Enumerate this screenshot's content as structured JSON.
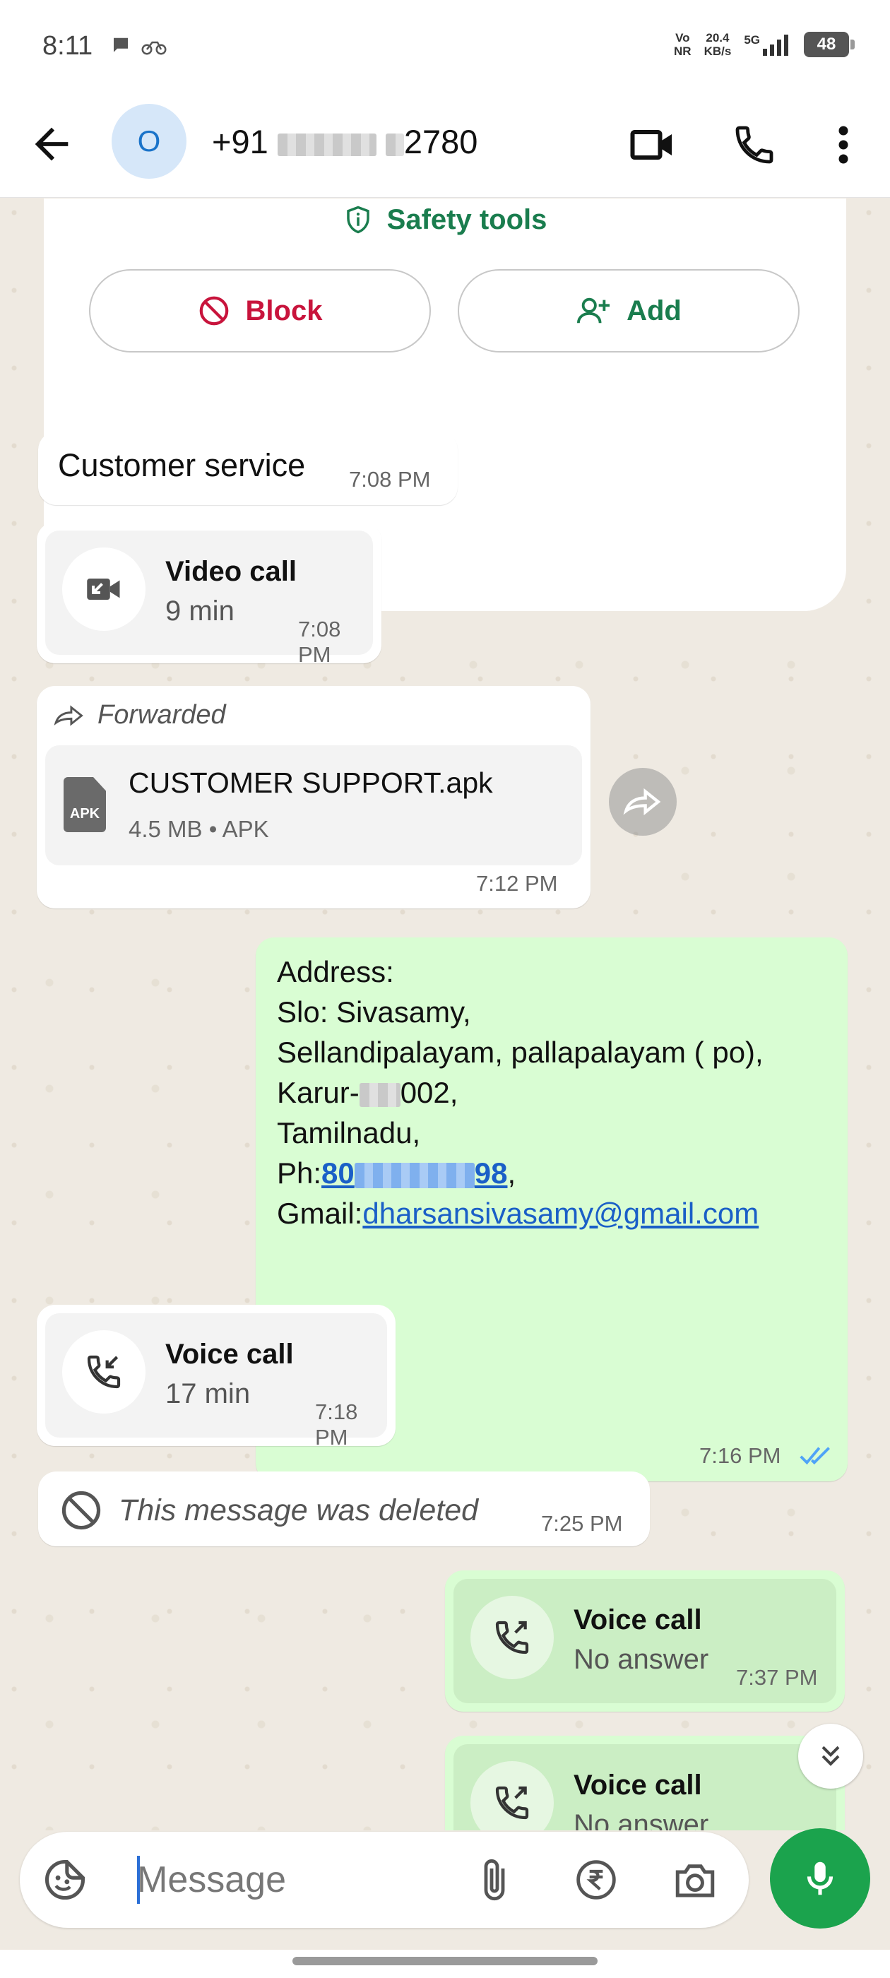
{
  "status_bar": {
    "time": "8:11",
    "volte": [
      "Vo",
      "NR"
    ],
    "speed": [
      "20.4",
      "KB/s"
    ],
    "network": "5G",
    "battery": "48"
  },
  "header": {
    "avatar_letter": "O",
    "phone_prefix": "+91",
    "phone_suffix": "2780"
  },
  "profile_card": {
    "safety_label": "Safety tools",
    "block_label": "Block",
    "add_label": "Add"
  },
  "messages": {
    "customer_service": {
      "text": "Customer service",
      "time": "7:08 PM"
    },
    "video_call": {
      "title": "Video call",
      "duration": "9 min",
      "time": "7:08 PM"
    },
    "forwarded_file": {
      "forwarded_label": "Forwarded",
      "file_name": "CUSTOMER SUPPORT.apk",
      "file_icon_label": "APK",
      "file_meta": "4.5 MB • APK",
      "time": "7:12 PM"
    },
    "address": {
      "line1": "Address:",
      "line2": "Slo: Sivasamy,",
      "line3": "Sellandipalayam, pallapalayam ( po),",
      "line4a": "Karur-",
      "line4b": "002,",
      "line5": "Tamilnadu,",
      "ph_label": "Ph:",
      "ph_start": "80",
      "ph_end": "98",
      "ph_comma": ",",
      "gmail_label": "Gmail:",
      "email": "dharsansivasamy@gmail.com",
      "time": "7:16 PM"
    },
    "voice_call_in": {
      "title": "Voice call",
      "duration": "17 min",
      "time": "7:18 PM"
    },
    "deleted": {
      "text": "This message was deleted",
      "time": "7:25 PM"
    },
    "voice_call_out1": {
      "title": "Voice call",
      "status": "No answer",
      "time": "7:37 PM"
    },
    "voice_call_out2": {
      "title": "Voice call",
      "status": "No answer"
    }
  },
  "input": {
    "placeholder": "Message"
  },
  "colors": {
    "accent_green": "#1ba34d",
    "outgoing_bubble": "#d9fdd3",
    "block_red": "#c8143c",
    "link_blue": "#1a5fc7",
    "read_ticks": "#4fa3f7"
  }
}
